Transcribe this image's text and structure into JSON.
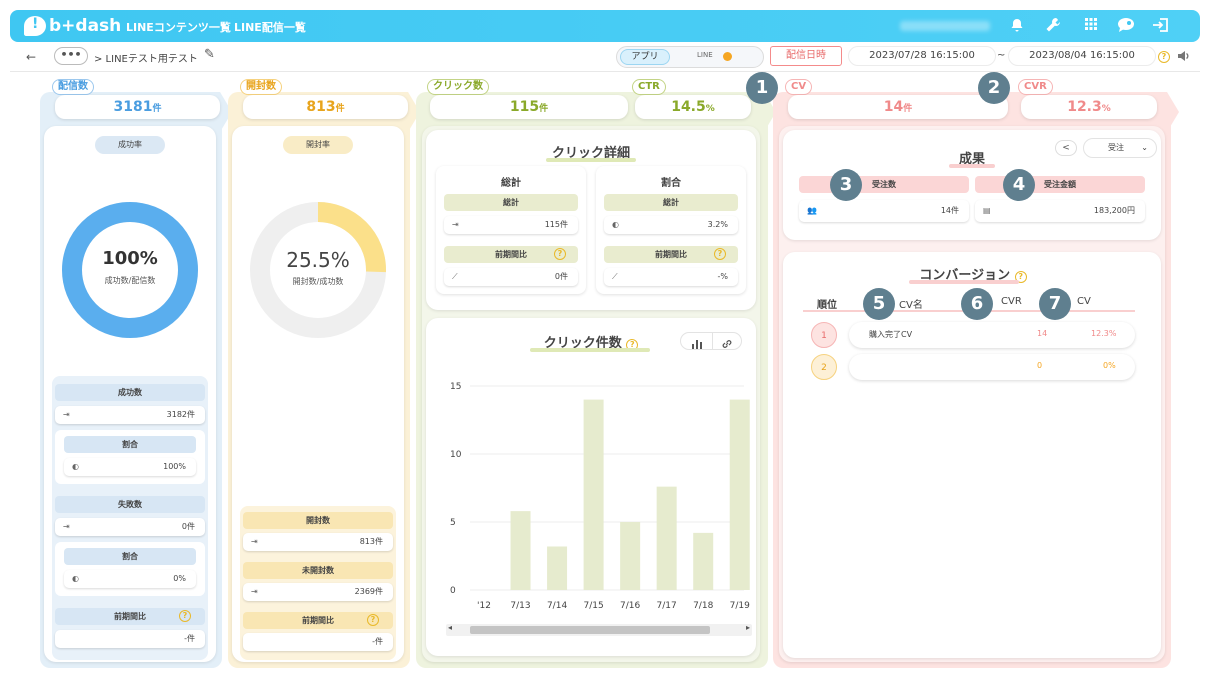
{
  "header": {
    "logo_text": "b+dash",
    "nav": [
      "LINEコンテンツ一覧",
      "LINE配信一覧"
    ]
  },
  "subbar": {
    "back": "←",
    "more": "•••",
    "breadcrumb": "> LINEテスト用テスト",
    "toggle_app": "アプリ",
    "toggle_line": "LINE",
    "date_button": "配信日時",
    "date_from": "2023/07/28 16:15:00",
    "tilde": "~",
    "date_to": "2023/08/04 16:15:00"
  },
  "delivery": {
    "tab": "配信数",
    "value": "3181",
    "unit": "件",
    "rate_pill": "成功率",
    "donut_value": "100%",
    "donut_caption": "成功数/配信数",
    "donut_fraction": 1.0,
    "success_label": "成功数",
    "success_value": "3182件",
    "success_ratio_label": "割合",
    "success_ratio_value": "100%",
    "fail_label": "失敗数",
    "fail_value": "0件",
    "fail_ratio_label": "割合",
    "fail_ratio_value": "0%",
    "prev_label": "前期間比",
    "prev_value": "-件",
    "color": "#5aaeee"
  },
  "open": {
    "tab": "開封数",
    "value": "813",
    "unit": "件",
    "rate_pill": "開封率",
    "donut_value": "25.5%",
    "donut_caption": "開封数/成功数",
    "donut_fraction": 0.255,
    "open_label": "開封数",
    "open_value": "813件",
    "unopened_label": "未開封数",
    "unopened_value": "2369件",
    "prev_label": "前期間比",
    "prev_value": "-件",
    "color": "#fbe08a"
  },
  "click": {
    "tab": "クリック数",
    "value": "115",
    "unit": "件",
    "ctr_tab": "CTR",
    "ctr_value": "14.5",
    "ctr_unit": "%",
    "detail_title": "クリック詳細",
    "total_header": "総計",
    "total_sub": "総計",
    "total_value": "115件",
    "prev_label": "前期間比",
    "prev_value": "0件",
    "ratio_header": "割合",
    "ratio_sub": "総計",
    "ratio_value": "3.2%",
    "ratio_prev_label": "前期間比",
    "ratio_prev_value": "-%",
    "chart_title": "クリック件数"
  },
  "chart_data": {
    "type": "bar",
    "categories": [
      "7/12",
      "7/13",
      "7/14",
      "7/15",
      "7/16",
      "7/17",
      "7/18",
      "7/19"
    ],
    "visible_tick_labels": [
      "'12",
      "7/13",
      "7/14",
      "7/15",
      "7/16",
      "7/17",
      "7/18",
      "7/19"
    ],
    "values": [
      0,
      5.8,
      3.2,
      14,
      5,
      7.6,
      4.2,
      14
    ],
    "ylim": [
      0,
      15
    ],
    "yticks": [
      0,
      5,
      10,
      15
    ],
    "bar_color": "#e6ebce",
    "grid": true
  },
  "cv": {
    "badge_1": "1",
    "badge_2": "2",
    "cv_tab": "CV",
    "cv_value": "14",
    "cv_unit": "件",
    "cvr_tab": "CVR",
    "cvr_value": "12.3",
    "cvr_unit": "%",
    "results_title": "成果",
    "filter_value": "受注",
    "badge_3": "3",
    "badge_4": "4",
    "order_count_label": "受注数",
    "order_count_value": "14件",
    "order_amount_label": "受注金額",
    "order_amount_value": "183,200円",
    "conversion_title": "コンバージョン",
    "badge_5": "5",
    "badge_6": "6",
    "badge_7": "7",
    "col_rank": "順位",
    "col_name": "CV名",
    "col_cvr": "CVR",
    "col_cv": "CV",
    "rows": [
      {
        "rank": "1",
        "name": "購入完了CV",
        "cv": "14",
        "cvr": "12.3%"
      },
      {
        "rank": "2",
        "name": "",
        "cv": "0",
        "cvr": "0%"
      }
    ]
  }
}
